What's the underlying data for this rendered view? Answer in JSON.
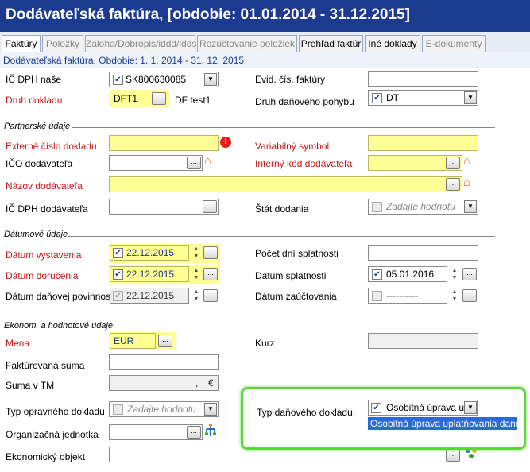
{
  "window": {
    "title": "Dodávateľská faktúra, [obdobie: 01.01.2014 - 31.12.2015]"
  },
  "tabs": [
    {
      "label": "Faktúry",
      "active": true
    },
    {
      "label": "Položky",
      "active": false
    },
    {
      "label": "Záloha/Dobropis/iddd/idds",
      "active": false
    },
    {
      "label": "Rozúčtovanie položiek",
      "active": false
    },
    {
      "label": "Prehľad faktúr",
      "active": false
    },
    {
      "label": "Iné doklady",
      "active": false
    },
    {
      "label": "E-dokumenty",
      "active": false
    }
  ],
  "band": {
    "text": "Dodávateľská faktúra, Obdobie: 1. 1. 2014 - 31. 12. 2015"
  },
  "sections": {
    "partner": "Partnerské údaje",
    "dates": "Dátumové údaje",
    "econ": "Ekonom. a hodnotové údaje"
  },
  "fields": {
    "ic_dph_nase": {
      "label": "IČ DPH naše",
      "value": "SK800630085",
      "checked": true
    },
    "evid_cis": {
      "label": "Evid. čís. faktúry",
      "value": ""
    },
    "druh_dokladu": {
      "label": "Druh dokladu",
      "value": "DFT1",
      "note": "DF test1"
    },
    "druh_dan_pohybu": {
      "label": "Druh daňového pohybu",
      "value": "DT",
      "checked": true
    },
    "ext_cislo": {
      "label": "Externé číslo dokladu",
      "value": ""
    },
    "var_symbol": {
      "label": "Variabilný symbol",
      "value": ""
    },
    "ico_dod": {
      "label": "IČO dodávateľa",
      "value": ""
    },
    "int_kod_dod": {
      "label": "Interný kód dodávateľa",
      "value": ""
    },
    "nazov_dod": {
      "label": "Názov dodávateľa",
      "value": ""
    },
    "ic_dph_dod": {
      "label": "IČ DPH dodávateľa",
      "value": ""
    },
    "stat_dodania": {
      "label": "Štát dodania",
      "placeholder": "Zadajte hodnotu"
    },
    "datum_vystavenia": {
      "label": "Dátum vystavenia",
      "value": "22.12.2015",
      "checked": true
    },
    "pocet_dni": {
      "label": "Počet dní splatnosti",
      "value": ""
    },
    "datum_dorucenia": {
      "label": "Dátum doručenia",
      "value": "22.12.2015",
      "checked": true
    },
    "datum_splatnosti": {
      "label": "Dátum splatnosti",
      "value": "05.01.2016",
      "checked": true
    },
    "datum_dan_pov": {
      "label": "Dátum daňovej povinnosti",
      "value": "22.12.2015",
      "checked": true
    },
    "datum_zauct": {
      "label": "Dátum zaúčtovania",
      "value": "----------",
      "checked": false
    },
    "mena": {
      "label": "Mena",
      "value": "EUR"
    },
    "kurz": {
      "label": "Kurz",
      "value": ""
    },
    "fakt_suma": {
      "label": "Faktúrovaná suma",
      "value": ""
    },
    "suma_tm": {
      "label": "Suma v TM",
      "value": ",",
      "currency": "€"
    },
    "typ_opr": {
      "label": "Typ opravného dokladu",
      "placeholder": "Zadajte hodnotu"
    },
    "typ_dan": {
      "label": "Typ daňového dokladu:",
      "value": "Osobitná úprava up",
      "checked": true,
      "dropdown_option": "Osobitná úprava uplatňovania dane"
    },
    "org_jedn": {
      "label": "Organizačná jednotka",
      "value": ""
    },
    "ekon_obj": {
      "label": "Ekonomický objekt",
      "value": ""
    }
  },
  "icons": {
    "browse": "ellipsis-button",
    "dropdown": "chevron-down-icon",
    "house": "house-icon",
    "alert": "alert-icon",
    "tree": "tree-icon",
    "people": "people-icon"
  },
  "colors": {
    "title_bg": "#1c3a8f",
    "required": "#c31818",
    "mandatory_field": "#ffff96",
    "highlight": "#58d63a",
    "selection": "#2b6ad4"
  }
}
